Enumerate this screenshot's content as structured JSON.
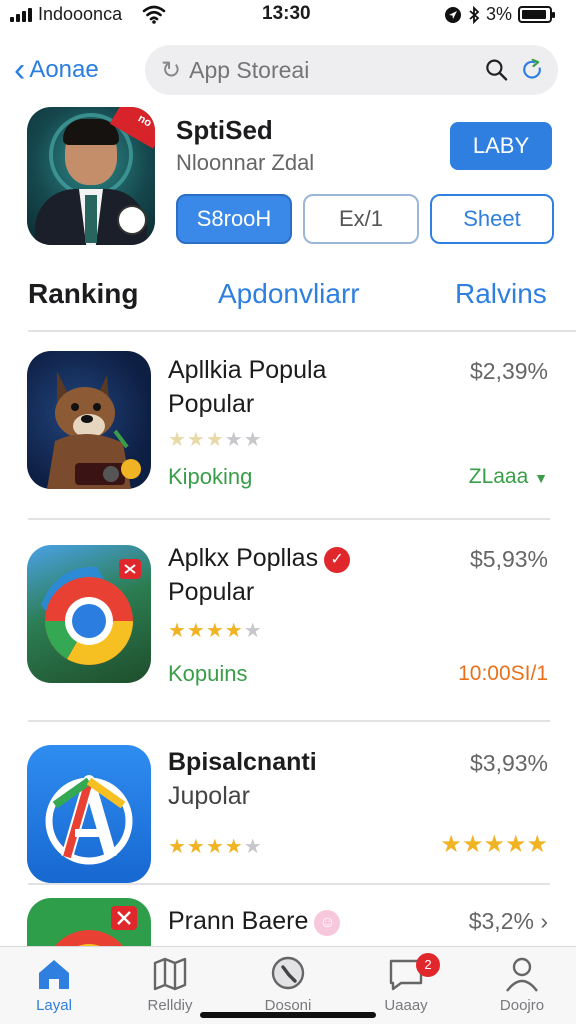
{
  "status_bar": {
    "carrier": "Indooonca",
    "time": "13:30",
    "battery": "3%"
  },
  "nav": {
    "back_label": "Aonae",
    "search_placeholder": "App Storeai"
  },
  "featured": {
    "title": "SptiSed",
    "subtitle": "Nloonnar Zdal",
    "primary_button": "LABY",
    "corner_badge": "no",
    "chips": [
      "S8rooH",
      "Ex/1",
      "Sheet"
    ]
  },
  "tabs": [
    "Ranking",
    "Apdonvliarr",
    "Ralvins"
  ],
  "apps": [
    {
      "title_line1": "Apllkia Popula",
      "title_line2": "Popular",
      "price": "$2,39%",
      "rating": 3,
      "category": "Kipoking",
      "trend": "ZLaaa",
      "trend_color": "#3a9e49",
      "icon": "dog-icon"
    },
    {
      "title_line1": "Aplkx Popllas",
      "title_line2": "Popular",
      "price": "$5,93%",
      "rating": 4,
      "category": "Kopuins",
      "trend": "10:00SI/1",
      "trend_color": "#e9711c",
      "icon": "chrome-icon"
    },
    {
      "title_line1": "Bpisalcnanti",
      "title_line2": "Jupolar",
      "price": "$3,93%",
      "rating": 4,
      "trend_stars": 5,
      "icon": "a-logo-icon"
    },
    {
      "title_line1": "Prann Baere",
      "price": "$3,2%",
      "icon": "target-icon"
    }
  ],
  "tab_bar": {
    "items": [
      "Layal",
      "Relldiy",
      "Dosoni",
      "Uaaay",
      "Doojro"
    ],
    "badge": "2"
  },
  "colors": {
    "accent": "#2f7fe0",
    "green": "#3a9e49",
    "orange": "#e9711c",
    "star": "#f0b323",
    "badge_red": "#e0272c"
  }
}
